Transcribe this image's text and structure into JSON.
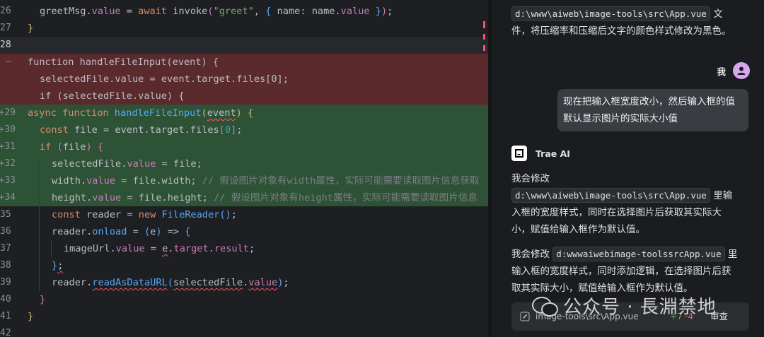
{
  "editor": {
    "lines": [
      {
        "ln": "26",
        "gutter": "",
        "type": "ctx",
        "indent": 1,
        "tokens": [
          {
            "t": "greetMsg",
            "c": "plain"
          },
          {
            "t": ".",
            "c": "plain"
          },
          {
            "t": "value",
            "c": "prop"
          },
          {
            "t": " = ",
            "c": "plain"
          },
          {
            "t": "await",
            "c": "kw"
          },
          {
            "t": " ",
            "c": "plain"
          },
          {
            "t": "invoke",
            "c": "plain"
          },
          {
            "t": "(",
            "c": "br2"
          },
          {
            "t": "\"greet\"",
            "c": "str"
          },
          {
            "t": ", ",
            "c": "plain"
          },
          {
            "t": "{",
            "c": "br3"
          },
          {
            "t": " name: ",
            "c": "plain"
          },
          {
            "t": "name",
            "c": "plain"
          },
          {
            "t": ".",
            "c": "plain"
          },
          {
            "t": "value",
            "c": "prop"
          },
          {
            "t": " ",
            "c": "plain"
          },
          {
            "t": "}",
            "c": "br3"
          },
          {
            "t": ")",
            "c": "br2"
          },
          {
            "t": ";",
            "c": "plain"
          }
        ]
      },
      {
        "ln": "27",
        "gutter": "",
        "type": "ctx",
        "indent": 0,
        "tokens": [
          {
            "t": "}",
            "c": "br1"
          }
        ]
      },
      {
        "ln": "28",
        "gutter": "",
        "type": "cur",
        "indent": 0,
        "tokens": []
      },
      {
        "ln": "",
        "gutter": "—",
        "type": "del",
        "indent": 0,
        "tokens": [
          {
            "t": "function handleFileInput(event) {",
            "c": "plain"
          }
        ]
      },
      {
        "ln": "",
        "gutter": "",
        "type": "del",
        "indent": 1,
        "tokens": [
          {
            "t": "selectedFile.value = event.target.files[0];",
            "c": "plain"
          }
        ]
      },
      {
        "ln": "",
        "gutter": "",
        "type": "del",
        "indent": 1,
        "tokens": [
          {
            "t": "if (selectedFile.value) {",
            "c": "plain"
          }
        ]
      },
      {
        "ln": "29+",
        "gutter": "",
        "type": "add",
        "indent": 0,
        "tokens": [
          {
            "t": "async",
            "c": "kw"
          },
          {
            "t": " ",
            "c": "plain"
          },
          {
            "t": "function",
            "c": "kw"
          },
          {
            "t": " ",
            "c": "plain"
          },
          {
            "t": "handleFileInput",
            "c": "fn"
          },
          {
            "t": "(",
            "c": "br1"
          },
          {
            "t": "event",
            "c": "plain sq"
          },
          {
            "t": ")",
            "c": "br1"
          },
          {
            "t": " ",
            "c": "plain"
          },
          {
            "t": "{",
            "c": "br1"
          }
        ]
      },
      {
        "ln": "30+",
        "gutter": "",
        "type": "add",
        "indent": 1,
        "tokens": [
          {
            "t": "const",
            "c": "kw"
          },
          {
            "t": " file = event.target.files",
            "c": "plain"
          },
          {
            "t": "[",
            "c": "br2"
          },
          {
            "t": "0",
            "c": "num"
          },
          {
            "t": "]",
            "c": "br2"
          },
          {
            "t": ";",
            "c": "plain"
          }
        ]
      },
      {
        "ln": "31+",
        "gutter": "",
        "type": "add",
        "indent": 1,
        "tokens": [
          {
            "t": "if",
            "c": "kw"
          },
          {
            "t": " ",
            "c": "plain"
          },
          {
            "t": "(",
            "c": "br2"
          },
          {
            "t": "file",
            "c": "plain"
          },
          {
            "t": ")",
            "c": "br2"
          },
          {
            "t": " ",
            "c": "plain"
          },
          {
            "t": "{",
            "c": "br2"
          }
        ]
      },
      {
        "ln": "32+",
        "gutter": "",
        "type": "add",
        "indent": 2,
        "tokens": [
          {
            "t": "selectedFile",
            "c": "plain"
          },
          {
            "t": ".",
            "c": "plain"
          },
          {
            "t": "value",
            "c": "prop"
          },
          {
            "t": " = file;",
            "c": "plain"
          }
        ]
      },
      {
        "ln": "33+",
        "gutter": "",
        "type": "add",
        "indent": 2,
        "tokens": [
          {
            "t": "width",
            "c": "plain"
          },
          {
            "t": ".",
            "c": "plain"
          },
          {
            "t": "value",
            "c": "prop"
          },
          {
            "t": " = file.width; ",
            "c": "plain"
          },
          {
            "t": "// 假设图片对象有width属性，实际可能需要读取图片信息获取",
            "c": "cmt"
          }
        ]
      },
      {
        "ln": "34+",
        "gutter": "",
        "type": "add",
        "indent": 2,
        "tokens": [
          {
            "t": "height",
            "c": "plain"
          },
          {
            "t": ".",
            "c": "plain"
          },
          {
            "t": "value",
            "c": "prop"
          },
          {
            "t": " = file.height; ",
            "c": "plain"
          },
          {
            "t": "// 假设图片对象有height属性，实际可能需要读取图片信息",
            "c": "cmt"
          }
        ]
      },
      {
        "ln": "35",
        "gutter": "",
        "type": "ctx",
        "indent": 2,
        "tokens": [
          {
            "t": "const",
            "c": "kw"
          },
          {
            "t": " reader = ",
            "c": "plain"
          },
          {
            "t": "new",
            "c": "kw"
          },
          {
            "t": " ",
            "c": "plain"
          },
          {
            "t": "FileReader",
            "c": "fn"
          },
          {
            "t": "(",
            "c": "br3"
          },
          {
            "t": ")",
            "c": "br3"
          },
          {
            "t": ";",
            "c": "plain"
          }
        ]
      },
      {
        "ln": "36",
        "gutter": "",
        "type": "ctx",
        "indent": 2,
        "tokens": [
          {
            "t": "reader",
            "c": "plain"
          },
          {
            "t": ".",
            "c": "plain"
          },
          {
            "t": "onload",
            "c": "fn"
          },
          {
            "t": " = ",
            "c": "plain"
          },
          {
            "t": "(",
            "c": "br3"
          },
          {
            "t": "e",
            "c": "plain"
          },
          {
            "t": ")",
            "c": "br3"
          },
          {
            "t": " => ",
            "c": "plain"
          },
          {
            "t": "{",
            "c": "br3"
          }
        ]
      },
      {
        "ln": "37",
        "gutter": "",
        "type": "ctx",
        "indent": 3,
        "tokens": [
          {
            "t": "imageUrl",
            "c": "plain"
          },
          {
            "t": ".",
            "c": "plain"
          },
          {
            "t": "value",
            "c": "prop"
          },
          {
            "t": " = ",
            "c": "plain"
          },
          {
            "t": "e",
            "c": "plain sq"
          },
          {
            "t": ".",
            "c": "plain"
          },
          {
            "t": "target",
            "c": "prop"
          },
          {
            "t": ".",
            "c": "plain"
          },
          {
            "t": "result",
            "c": "prop"
          },
          {
            "t": ";",
            "c": "plain"
          }
        ]
      },
      {
        "ln": "38",
        "gutter": "",
        "type": "ctx",
        "indent": 2,
        "tokens": [
          {
            "t": "}",
            "c": "br3"
          },
          {
            "t": ";",
            "c": "plain sq"
          }
        ]
      },
      {
        "ln": "39",
        "gutter": "",
        "type": "ctx",
        "indent": 2,
        "tokens": [
          {
            "t": "reader",
            "c": "plain"
          },
          {
            "t": ".",
            "c": "plain"
          },
          {
            "t": "readAsDataURL",
            "c": "fn sq"
          },
          {
            "t": "(",
            "c": "br3"
          },
          {
            "t": "selectedFile",
            "c": "plain sq"
          },
          {
            "t": ".",
            "c": "plain"
          },
          {
            "t": "value",
            "c": "prop sq"
          },
          {
            "t": ")",
            "c": "br3"
          },
          {
            "t": ";",
            "c": "plain"
          }
        ]
      },
      {
        "ln": "40",
        "gutter": "",
        "type": "ctx",
        "indent": 1,
        "tokens": [
          {
            "t": "}",
            "c": "br2"
          }
        ]
      },
      {
        "ln": "41",
        "gutter": "",
        "type": "ctx",
        "indent": 0,
        "tokens": [
          {
            "t": "}",
            "c": "br1"
          }
        ]
      },
      {
        "ln": "42",
        "gutter": "",
        "type": "ctx",
        "indent": 0,
        "tokens": []
      }
    ]
  },
  "chat": {
    "top_tag": "d:\\www\\aiweb\\image-tools\\src\\App.vue",
    "top_text_1": "文",
    "top_text_2": "件，将压缩率和压缩后文字的颜色样式修改为黑色。",
    "user_label": "我",
    "user_message": "现在把输入框宽度改小，然后输入框的值默认显示图片的实际大小值",
    "ai_label": "Trae AI",
    "ai_p1_lead": "我会修改",
    "ai_p1_tag": "d:\\www\\aiweb\\image-tools\\src\\App.vue",
    "ai_p1_text_a": "里输",
    "ai_p1_text_b": "入框的宽度样式，同时在选择图片后获取其实际大",
    "ai_p1_text_c": "小，赋值给输入框作为默认值。",
    "ai_p2_lead": "我会修改",
    "ai_p2_tag": "d:wwwaiwebimage-toolssrcApp.vue",
    "ai_p2_text_a": "里",
    "ai_p2_text_b": "输入框的宽度样式，同时添加逻辑，在选择图片后获",
    "ai_p2_text_c": "取其实际大小，赋值给输入框作为默认值。",
    "file_name": "image-tools\\src\\App.vue",
    "diff_add": "+7",
    "diff_del": "-4",
    "review_label": "审查"
  },
  "watermark": {
    "text": "公众号 · 長淵禁地"
  },
  "colors": {
    "deleted_line_bg": "#5a2a2d",
    "added_line_bg": "#2e5235",
    "keyword": "#cf8e6d",
    "function": "#56a8f5",
    "string": "#6aab73",
    "comment": "#7a7e85",
    "error_underline": "#f75464",
    "avatar": "#d6a7ef"
  }
}
